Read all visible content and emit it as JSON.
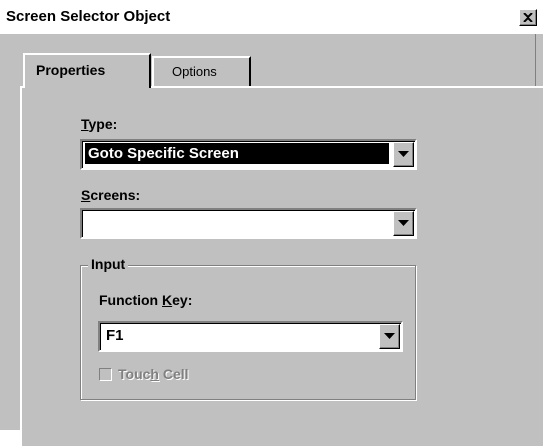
{
  "window": {
    "title": "Screen Selector Object",
    "close_icon": "close-icon"
  },
  "tabs": [
    {
      "label": "Properties",
      "active": true
    },
    {
      "label": "Options",
      "active": false
    }
  ],
  "type_field": {
    "label_prefix": "",
    "label_accel": "T",
    "label_rest": "ype:",
    "value": "Goto Specific Screen"
  },
  "screens_field": {
    "label_accel": "S",
    "label_rest": "creens:",
    "value": ""
  },
  "input_group": {
    "legend": "Input",
    "function_key": {
      "label_pre": "Function ",
      "label_accel": "K",
      "label_rest": "ey:",
      "value": "F1"
    },
    "touch_cell": {
      "label_pre": "Touc",
      "label_accel": "h",
      "label_rest": " Cell",
      "checked": false,
      "enabled": false
    }
  },
  "colors": {
    "face": "#c0c0c0",
    "highlight": "#ffffff",
    "shadow": "#808080",
    "dark": "#000000"
  }
}
